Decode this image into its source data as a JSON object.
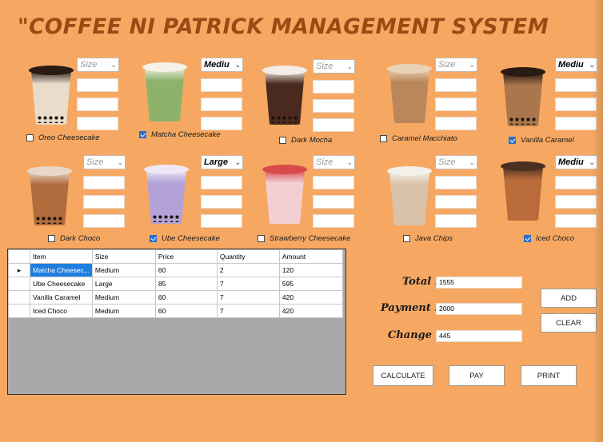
{
  "title": "\"COFFEE NI PATRICK MANAGEMENT SYSTEM",
  "products": [
    {
      "name": "Oreo Cheesecake",
      "size": "Size",
      "size_placeholder": true,
      "checked": false
    },
    {
      "name": "Matcha Cheesecake",
      "size": "Mediu",
      "size_placeholder": false,
      "checked": true
    },
    {
      "name": "Dark Mocha",
      "size": "Size",
      "size_placeholder": true,
      "checked": false
    },
    {
      "name": "Caramel Macchiato",
      "size": "Size",
      "size_placeholder": true,
      "checked": false
    },
    {
      "name": "Vanilla Caramel",
      "size": "Mediu",
      "size_placeholder": false,
      "checked": true
    },
    {
      "name": "Dark Choco",
      "size": "Size",
      "size_placeholder": true,
      "checked": false
    },
    {
      "name": "Ube Cheesecake",
      "size": "Large",
      "size_placeholder": false,
      "checked": true
    },
    {
      "name": "Strawberry Cheesecake",
      "size": "Size",
      "size_placeholder": true,
      "checked": false
    },
    {
      "name": "Java Chips",
      "size": "Size",
      "size_placeholder": true,
      "checked": false
    },
    {
      "name": "Iced Choco",
      "size": "Mediu",
      "size_placeholder": false,
      "checked": true
    }
  ],
  "grid": {
    "columns": [
      "Item",
      "Size",
      "Price",
      "Quantity",
      "Amount"
    ],
    "rows": [
      [
        "Matcha Cheesec...",
        "Medium",
        "60",
        "2",
        "120"
      ],
      [
        "Ube Cheesecake",
        "Large",
        "85",
        "7",
        "595"
      ],
      [
        "Vanilla Caramel",
        "Medium",
        "60",
        "7",
        "420"
      ],
      [
        "Iced Choco",
        "Medium",
        "60",
        "7",
        "420"
      ]
    ]
  },
  "summary": {
    "total_label": "Total :",
    "total": "1555",
    "payment_label": "Payment :",
    "payment": "2000",
    "change_label": "Change :",
    "change": "445"
  },
  "buttons": {
    "add": "ADD",
    "clear": "CLEAR",
    "calculate": "CALCULATE",
    "pay": "PAY",
    "print": "PRINT"
  },
  "icons": {
    "dropdown": "chevron-down-icon",
    "row_pointer": "row-pointer-icon"
  }
}
